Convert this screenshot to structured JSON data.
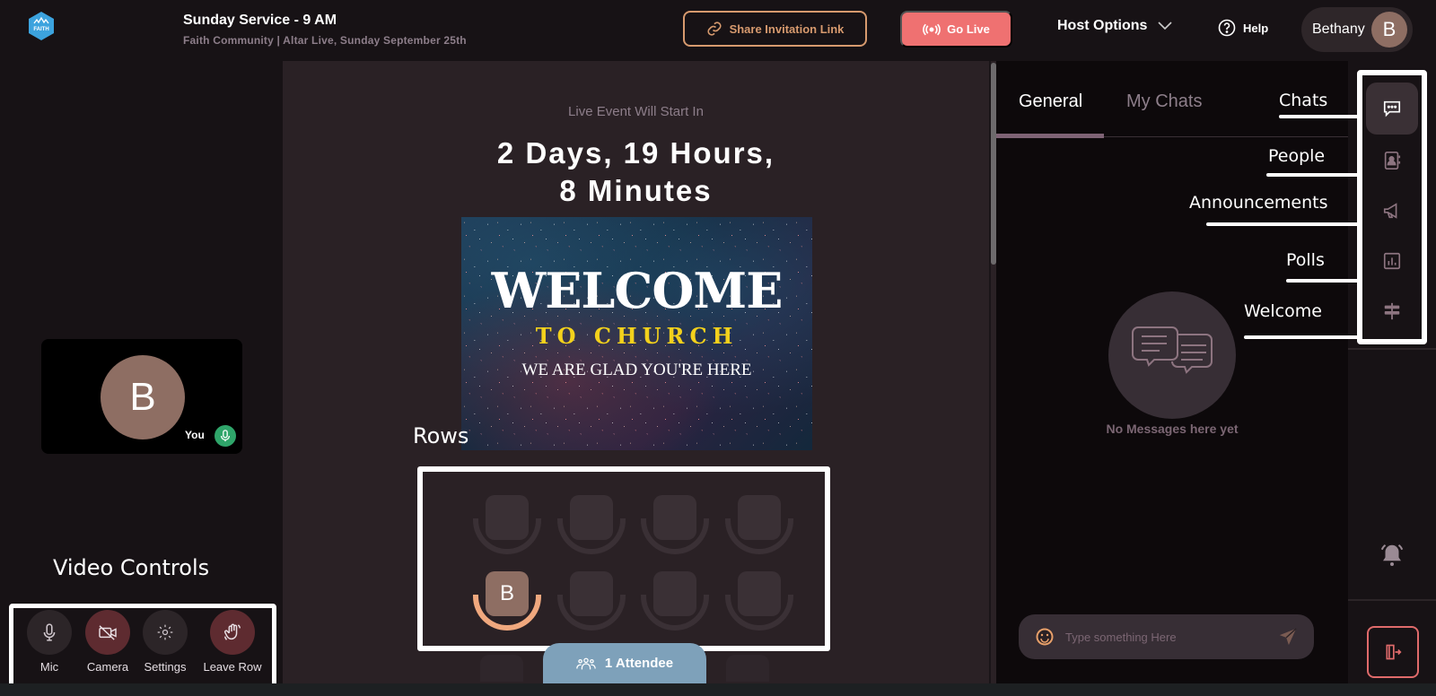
{
  "header": {
    "logo_text": "FAITH",
    "title": "Sunday Service - 9 AM",
    "subtitle": "Faith Community | Altar Live, Sunday September 25th",
    "share_button": "Share Invitation Link",
    "go_live_button": "Go Live",
    "host_options": "Host Options",
    "help": "Help",
    "user_name": "Bethany",
    "user_initial": "B"
  },
  "self_video": {
    "initial": "B",
    "label": "You",
    "mic_status": "on"
  },
  "video_controls": {
    "annotation": "Video Controls",
    "items": [
      {
        "label": "Mic",
        "icon": "mic-icon",
        "state": "neutral"
      },
      {
        "label": "Camera",
        "icon": "camera-off-icon",
        "state": "off"
      },
      {
        "label": "Settings",
        "icon": "gear-icon",
        "state": "neutral"
      },
      {
        "label": "Leave Row",
        "icon": "wave-hand-icon",
        "state": "danger"
      }
    ]
  },
  "center": {
    "countdown_label": "Live Event Will Start In",
    "countdown_line1": "2 Days, 19 Hours,",
    "countdown_line2": "8 Minutes",
    "welcome_image": {
      "title": "WELCOME",
      "subtitle": "TO CHURCH",
      "tagline": "WE ARE GLAD YOU'RE HERE"
    },
    "rows_annotation": "Rows",
    "rows": [
      [
        {
          "occupied": false
        },
        {
          "occupied": false
        },
        {
          "occupied": false
        },
        {
          "occupied": false
        }
      ],
      [
        {
          "occupied": true,
          "initial": "B"
        },
        {
          "occupied": false
        },
        {
          "occupied": false
        },
        {
          "occupied": false
        }
      ]
    ],
    "attendee_count": "1 Attendee"
  },
  "chat": {
    "tabs": [
      {
        "label": "General",
        "active": true
      },
      {
        "label": "My Chats",
        "active": false
      }
    ],
    "empty_text": "No Messages here yet",
    "input_placeholder": "Type something Here",
    "input_value": ""
  },
  "rail": {
    "items": [
      {
        "name": "Chats",
        "icon": "chat-icon",
        "active": true
      },
      {
        "name": "People",
        "icon": "contacts-icon",
        "active": false
      },
      {
        "name": "Announcements",
        "icon": "megaphone-icon",
        "active": false
      },
      {
        "name": "Polls",
        "icon": "poll-chart-icon",
        "active": false
      },
      {
        "name": "Welcome",
        "icon": "signpost-icon",
        "active": false
      }
    ]
  },
  "colors": {
    "accent_orange": "#d79a6e",
    "go_live_red": "#ef7171",
    "attendee_blue": "#7ea1ba",
    "mic_green": "#2fa56a",
    "avatar_brown": "#8e6e63",
    "muted_text": "#8d7e8a"
  }
}
